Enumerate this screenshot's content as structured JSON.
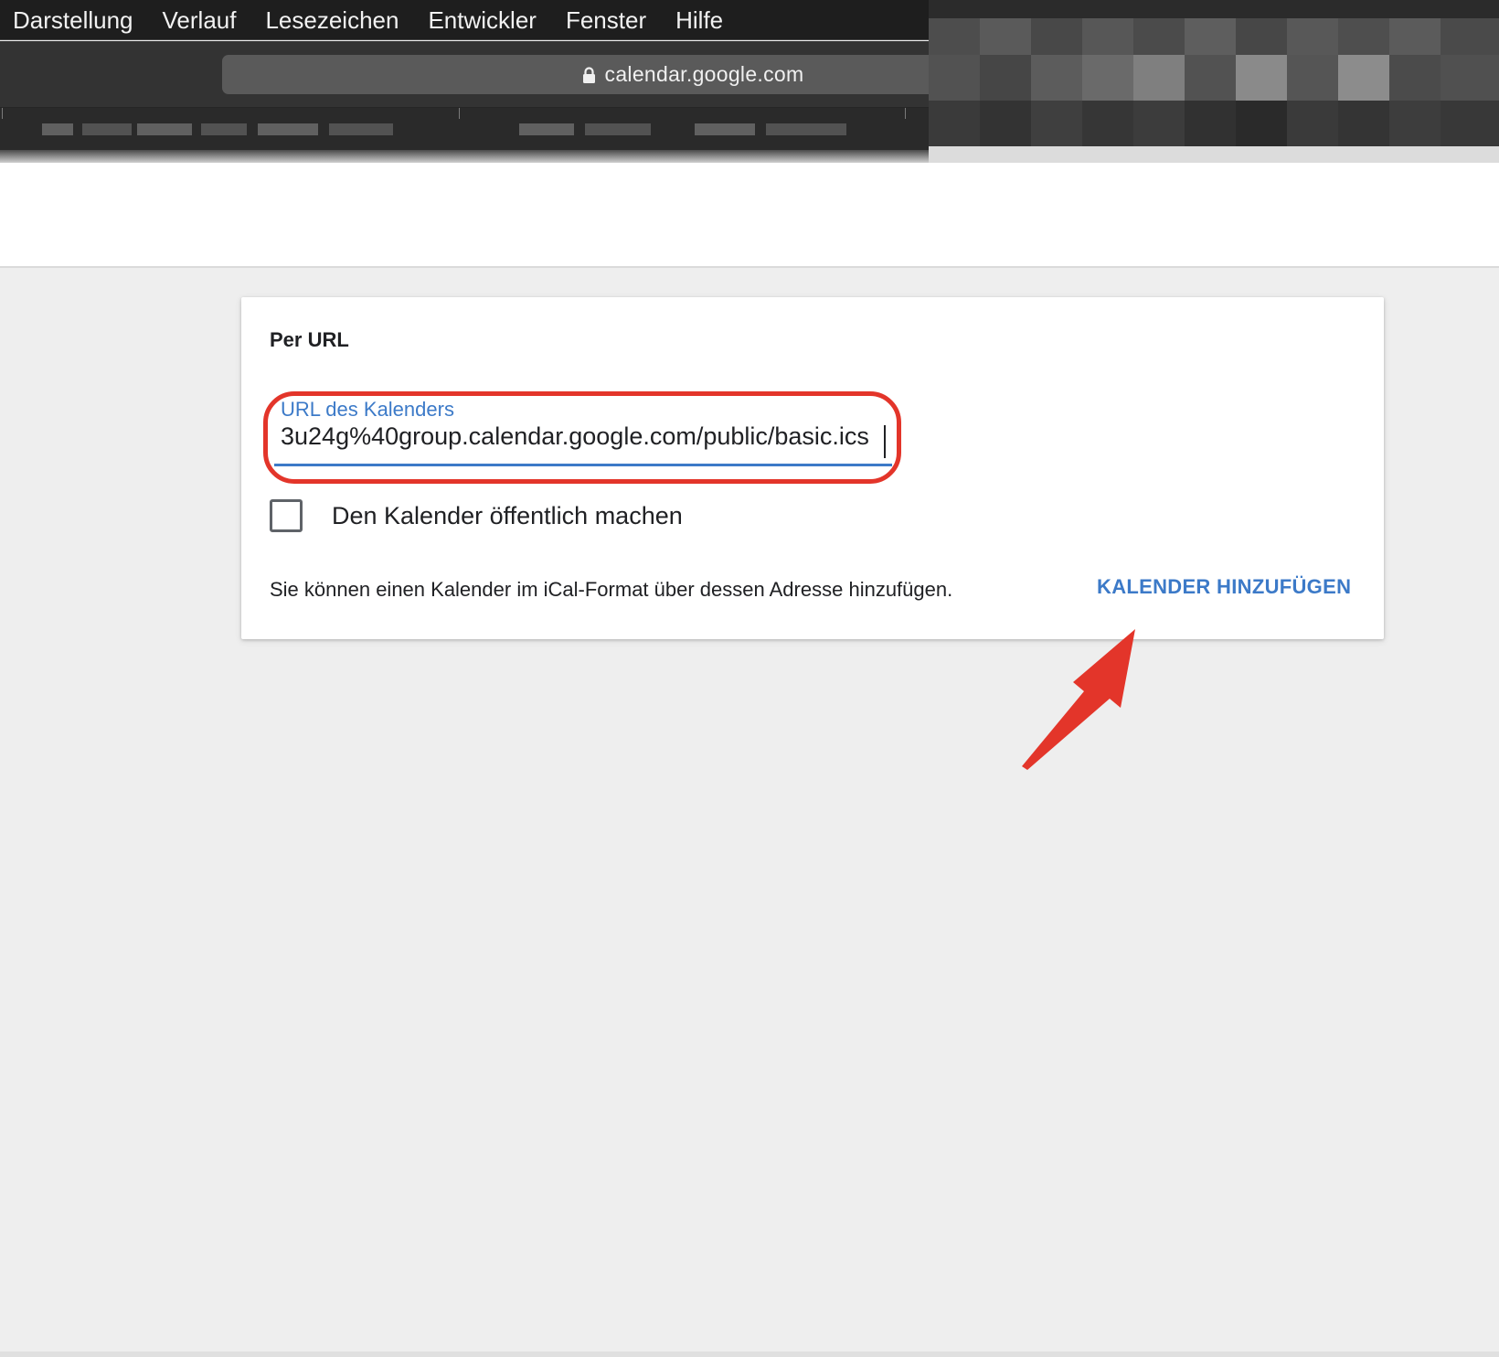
{
  "menubar": {
    "items": [
      "Darstellung",
      "Verlauf",
      "Lesezeichen",
      "Entwickler",
      "Fenster",
      "Hilfe"
    ]
  },
  "browser": {
    "address": "calendar.google.com"
  },
  "card": {
    "title": "Per URL",
    "url_field": {
      "label": "URL des Kalenders",
      "value": "3u24g%40group.calendar.google.com/public/basic.ics"
    },
    "checkbox": {
      "label": "Den Kalender öffentlich machen",
      "checked": false
    },
    "hint": "Sie können einen Kalender im iCal-Format über dessen Adresse hinzufügen.",
    "add_button": "KALENDER HINZUFÜGEN"
  },
  "colors": {
    "accent": "#3c7ac8",
    "annotation": "#e3352a"
  }
}
